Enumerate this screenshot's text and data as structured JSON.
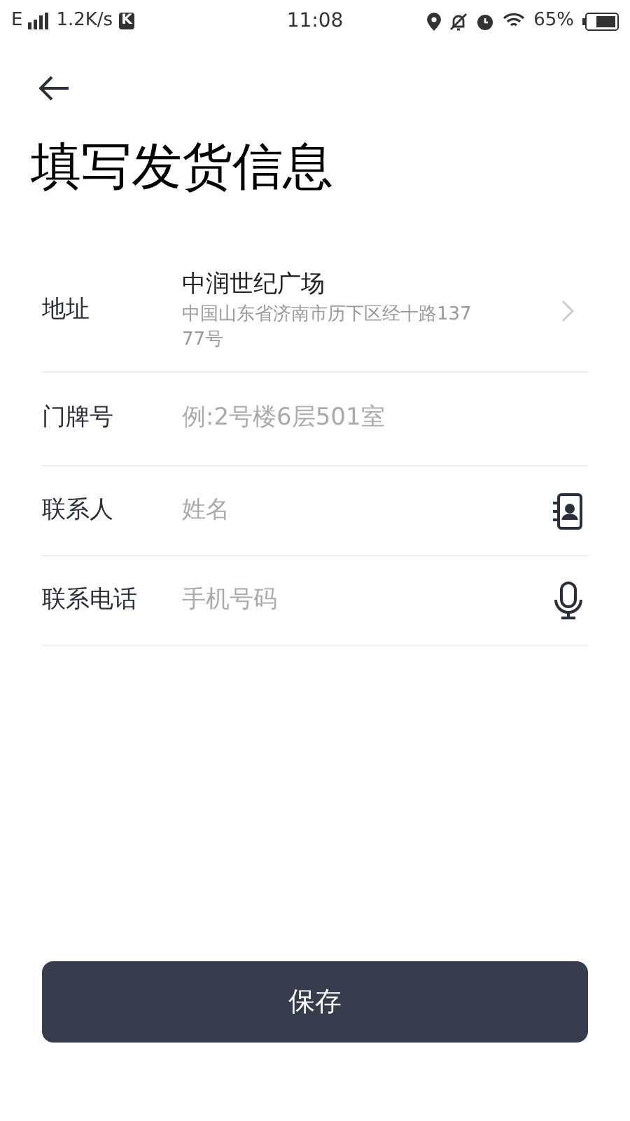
{
  "status_bar": {
    "network": "E",
    "speed": "1.2K/s",
    "badge": "K",
    "time": "11:08",
    "battery": "65%"
  },
  "title": "填写发货信息",
  "form": [
    {
      "kind": "address",
      "label": "地址",
      "name": "中润世纪广场",
      "detail": "中国山东省济南市历下区经十路13777号"
    },
    {
      "kind": "field",
      "label": "门牌号",
      "placeholder": "例:2号楼6层501室"
    },
    {
      "kind": "contact",
      "label": "联系人",
      "placeholder": "姓名"
    },
    {
      "kind": "phone",
      "label": "联系电话",
      "placeholder": "手机号码"
    }
  ],
  "save_button": "保存"
}
